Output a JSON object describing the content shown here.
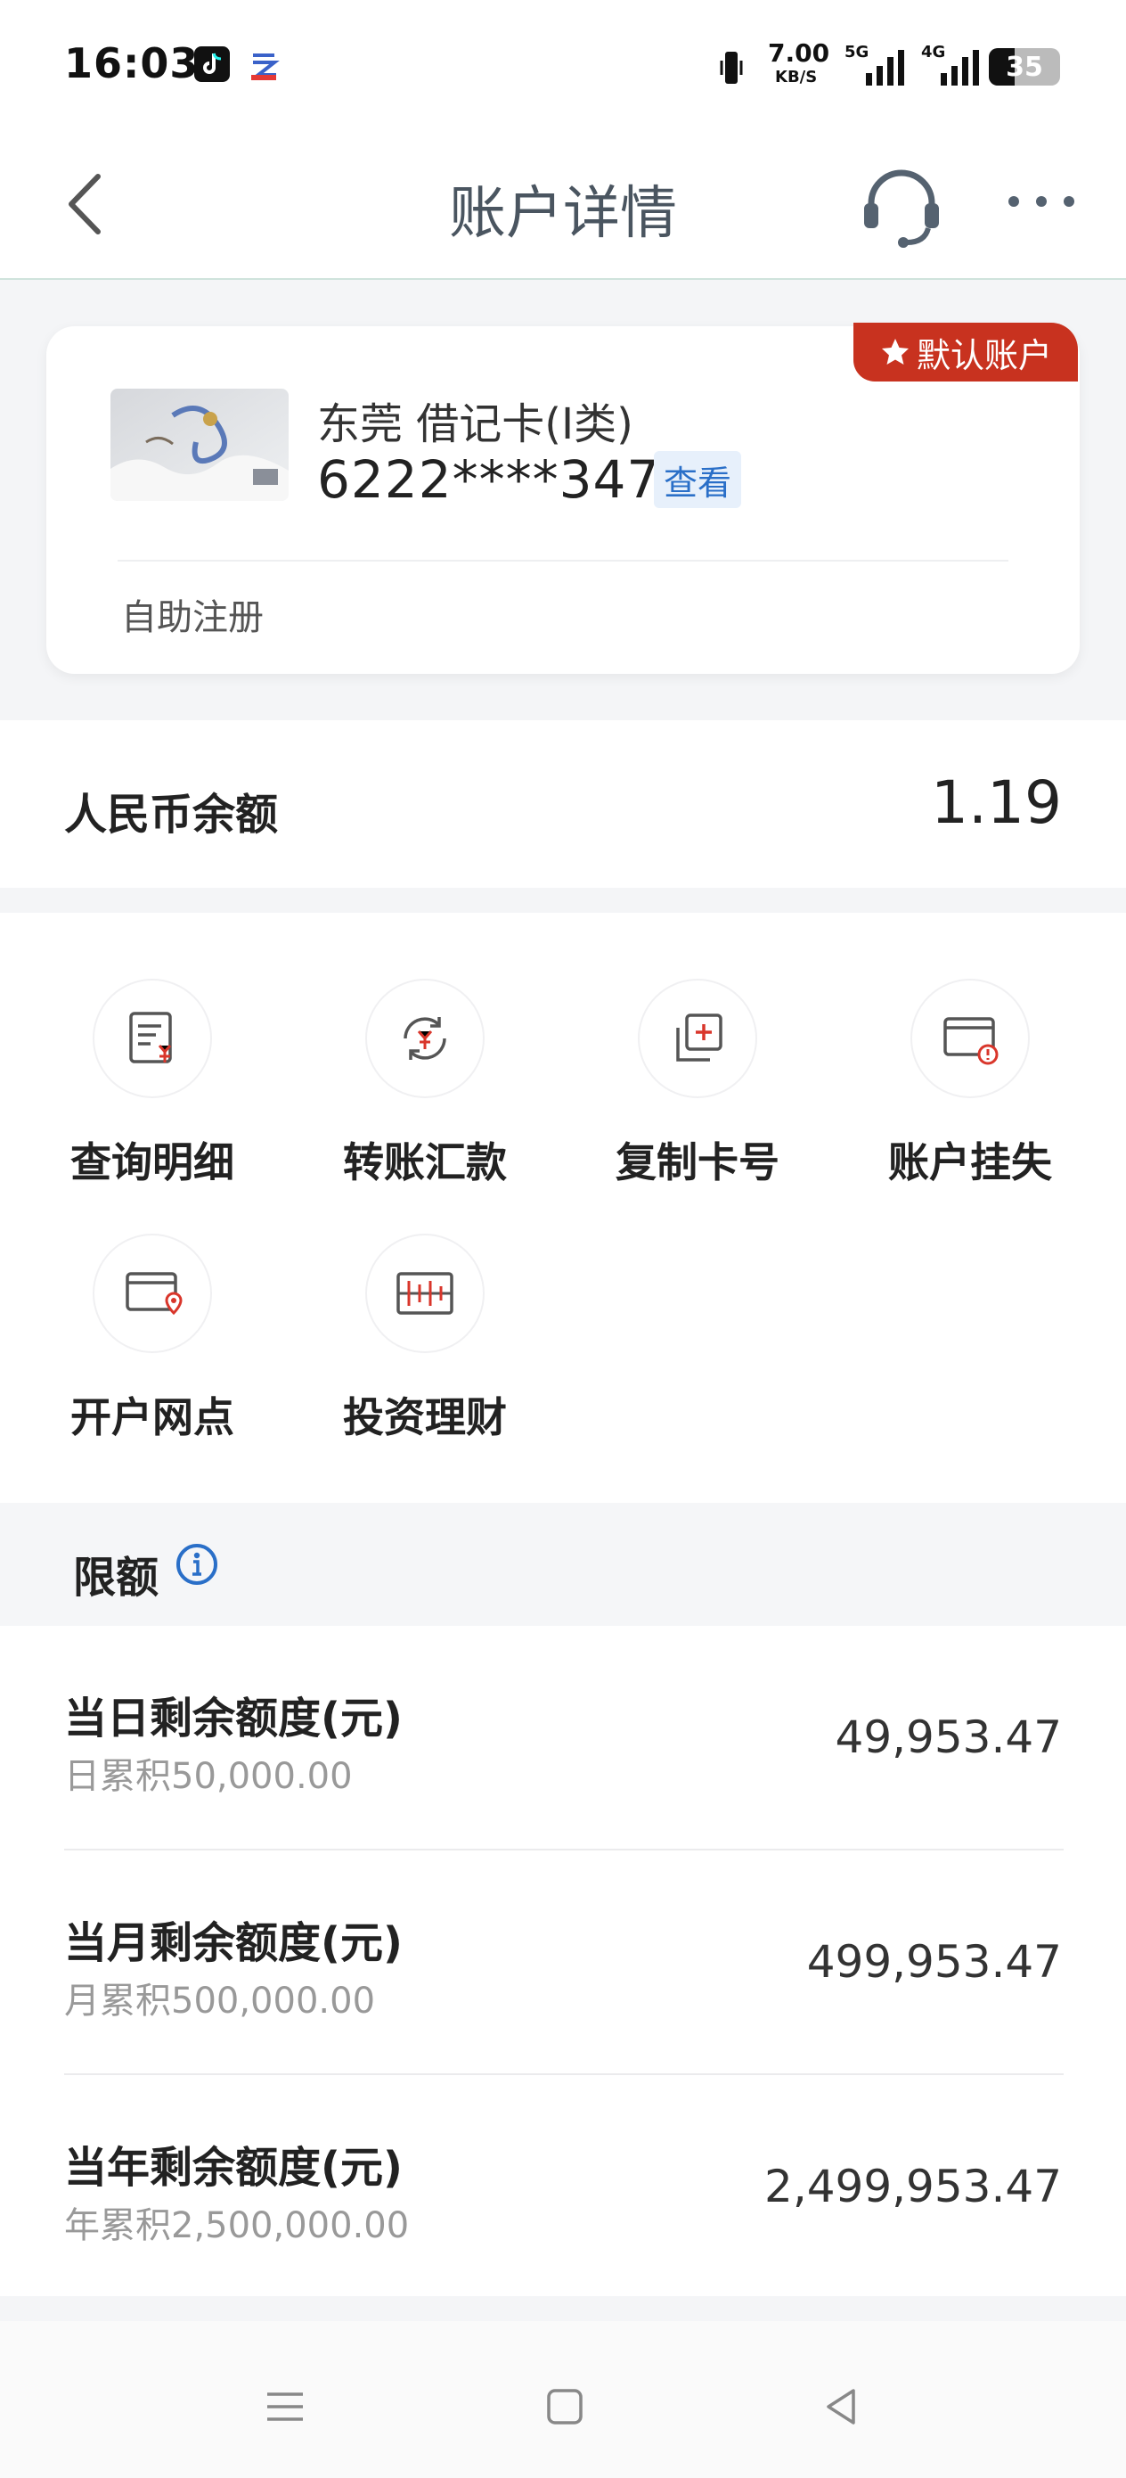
{
  "status_bar": {
    "time": "16:03",
    "net_speed_value": "7.00",
    "net_speed_unit": "KB/S",
    "signal_1": "5G",
    "signal_2": "4G",
    "battery": "35"
  },
  "header": {
    "title": "账户详情"
  },
  "card": {
    "badge": "默认账户",
    "name": "东莞 借记卡(I类)",
    "number": "6222****3479",
    "view_label": "查看",
    "self_register": "自助注册"
  },
  "balance": {
    "label": "人民币余额",
    "value": "1.19"
  },
  "functions": [
    {
      "label": "查询明细",
      "icon": "statement-icon"
    },
    {
      "label": "转账汇款",
      "icon": "transfer-icon"
    },
    {
      "label": "复制卡号",
      "icon": "copy-card-icon"
    },
    {
      "label": "账户挂失",
      "icon": "report-loss-icon"
    },
    {
      "label": "开户网点",
      "icon": "branch-location-icon"
    },
    {
      "label": "投资理财",
      "icon": "invest-icon"
    }
  ],
  "limits": {
    "title": "限额",
    "items": [
      {
        "title": "当日剩余额度(元)",
        "sub": "日累积50,000.00",
        "value": "49,953.47"
      },
      {
        "title": "当月剩余额度(元)",
        "sub": "月累积500,000.00",
        "value": "499,953.47"
      },
      {
        "title": "当年剩余额度(元)",
        "sub": "年累积2,500,000.00",
        "value": "2,499,953.47"
      }
    ]
  },
  "colors": {
    "accent_red": "#c8321f",
    "link_blue": "#2a6fc8",
    "icon_red": "#d9362b"
  }
}
